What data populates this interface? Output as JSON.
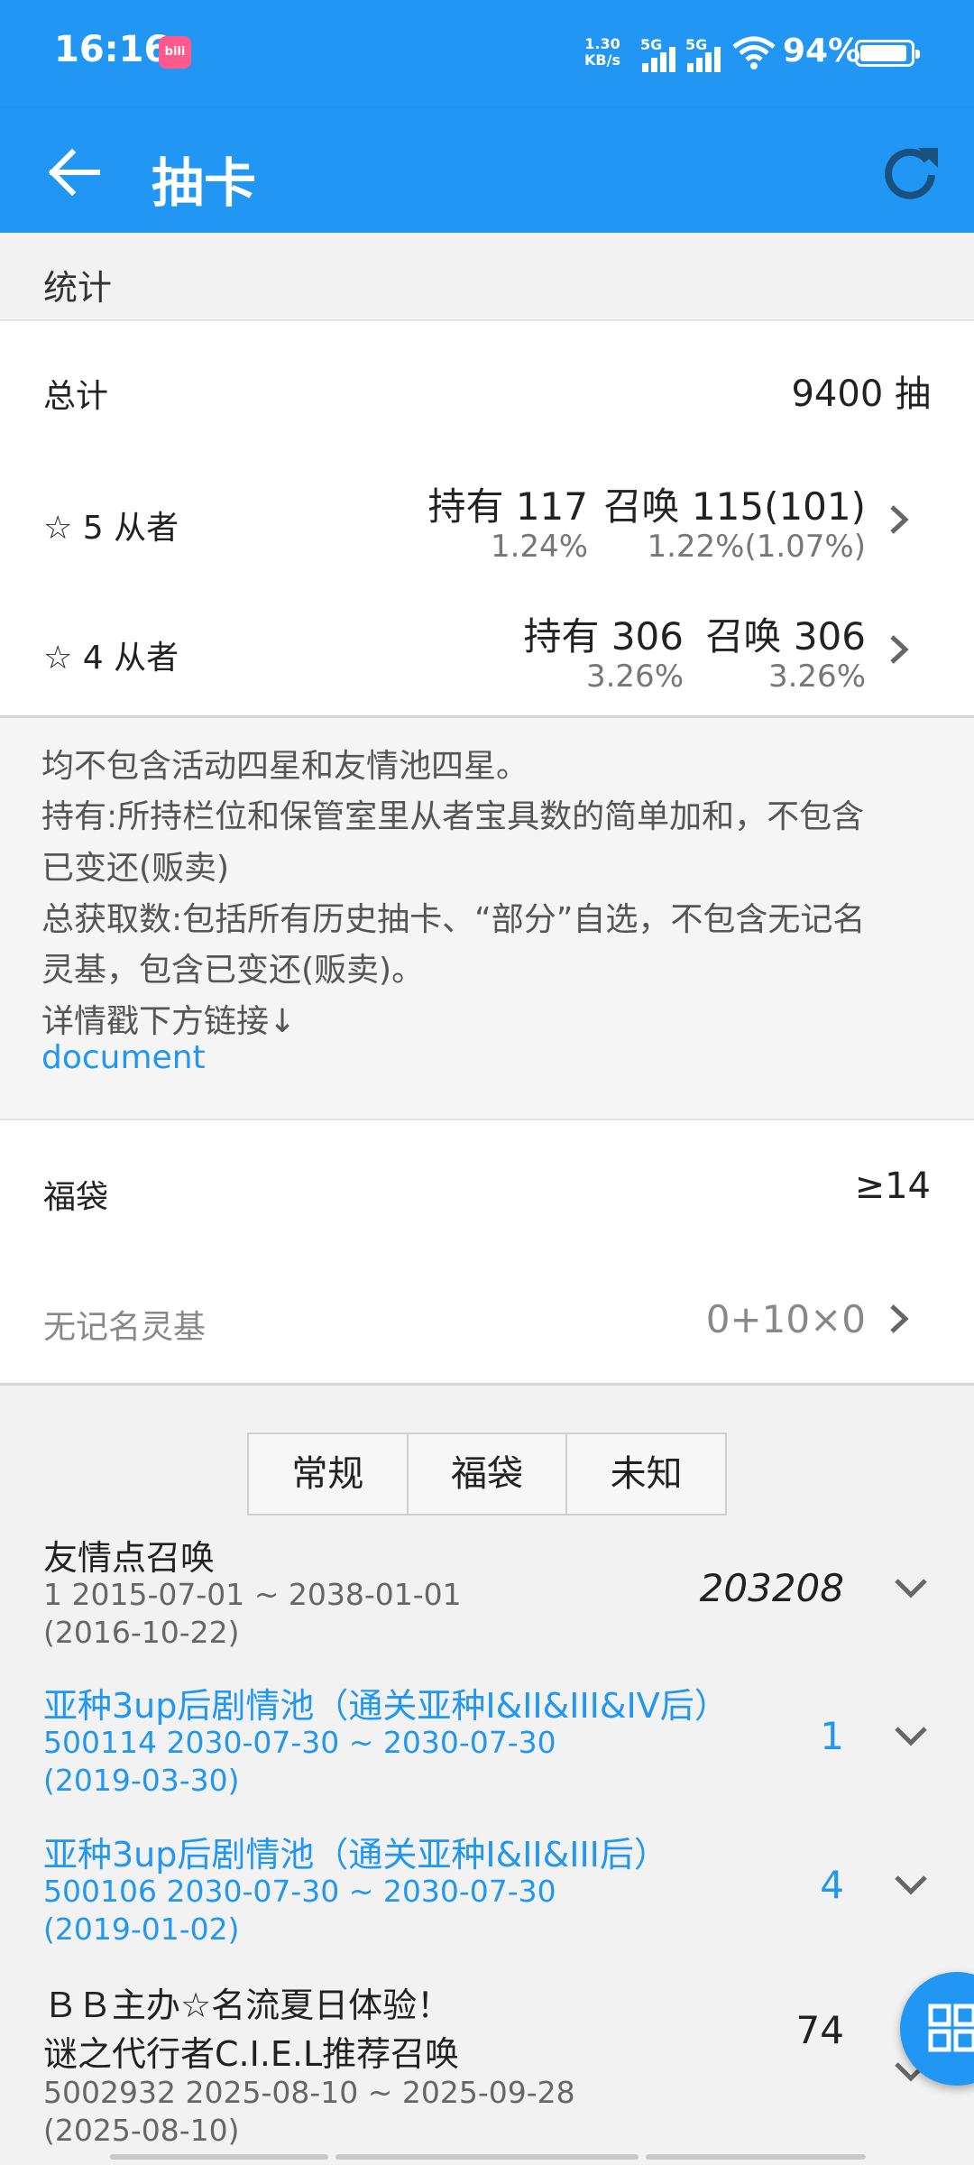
{
  "status": {
    "time": "16:16",
    "app_badge": "bilibili",
    "net_speed_value": "1.30",
    "net_speed_unit": "KB/s",
    "sim1": "5G",
    "sim2": "5G",
    "battery_pct": "94%",
    "battery_level": 0.94
  },
  "appbar": {
    "title": "抽卡",
    "back_icon": "arrow-left-icon",
    "refresh_icon": "refresh-icon"
  },
  "stats": {
    "header": "统计",
    "total_label": "总计",
    "total_value": "9400 抽",
    "five_star": {
      "label": "☆ 5 从者",
      "own": "持有 117",
      "summon": "召唤 115(101)",
      "own_pct": "1.24%",
      "summon_pct": "1.22%(1.07%)"
    },
    "four_star": {
      "label": "☆ 4 从者",
      "own": "持有 306",
      "summon": "召唤 306",
      "own_pct": "3.26%",
      "summon_pct": "3.26%"
    }
  },
  "notes": {
    "lines": [
      "均不包含活动四星和友情池四星。",
      "持有:所持栏位和保管室里从者宝具数的简单加和，不包含",
      "已变还(贩卖)",
      "总获取数:包括所有历史抽卡、“部分”自选，不包含无记名",
      "灵基，包含已变还(贩卖)。",
      "详情戳下方链接↓"
    ],
    "link": "document"
  },
  "lucky": {
    "label": "福袋",
    "value": "≥14",
    "unnamed_label": "无记名灵基",
    "unnamed_value": "0+10×0"
  },
  "tabs": [
    "常规",
    "福袋",
    "未知"
  ],
  "pools": [
    {
      "title": "友情点召唤",
      "meta1": "1   2015-07-01 ~ 2038-01-01",
      "meta2": "(2016-10-22)",
      "count": "203208"
    },
    {
      "title": "亚种3up后剧情池（通关亚种I&II&III&IV后）",
      "meta1": "500114   2030-07-30 ~ 2030-07-30",
      "meta2": "(2019-03-30)",
      "count": "1"
    },
    {
      "title": "亚种3up后剧情池（通关亚种I&II&III后）",
      "meta1": "500106   2030-07-30 ~ 2030-07-30",
      "meta2": "(2019-01-02)",
      "count": "4"
    },
    {
      "title": "ＢＢ主办☆名流夏日体验！",
      "title2": "谜之代行者C.I.E.L推荐召唤",
      "meta1": "5002932   2025-08-10 ~ 2025-09-28",
      "meta2": "(2025-08-10)",
      "count": "74"
    }
  ],
  "fab_icon": "grid-icon",
  "colors": {
    "primary": "#2196f3",
    "background": "#f2f2f2",
    "text": "#212121"
  }
}
